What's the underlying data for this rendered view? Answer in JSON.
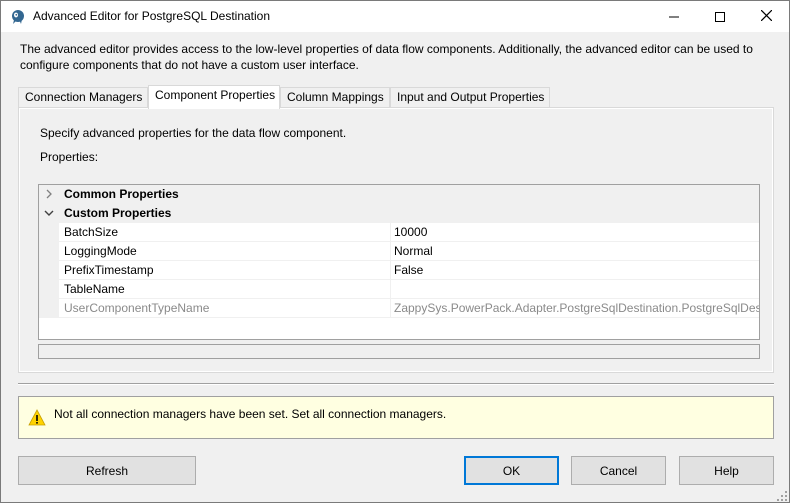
{
  "window": {
    "title": "Advanced Editor for PostgreSQL Destination"
  },
  "description": "The advanced editor provides access to the low-level properties of data flow components. Additionally, the advanced editor can be used to configure components that do not have a custom user interface.",
  "tabs": [
    {
      "label": "Connection Managers",
      "active": false
    },
    {
      "label": "Component Properties",
      "active": true
    },
    {
      "label": "Column Mappings",
      "active": false
    },
    {
      "label": "Input and Output Properties",
      "active": false
    }
  ],
  "panel": {
    "instruction": "Specify advanced properties for the data flow component.",
    "properties_label": "Properties:"
  },
  "grid": {
    "categories": [
      {
        "label": "Common Properties",
        "expanded": false
      },
      {
        "label": "Custom Properties",
        "expanded": true
      }
    ],
    "properties": [
      {
        "name": "BatchSize",
        "value": "10000",
        "readonly": false
      },
      {
        "name": "LoggingMode",
        "value": "Normal",
        "readonly": false
      },
      {
        "name": "PrefixTimestamp",
        "value": "False",
        "readonly": false
      },
      {
        "name": "TableName",
        "value": "",
        "readonly": false
      },
      {
        "name": "UserComponentTypeName",
        "value": "ZappySys.PowerPack.Adapter.PostgreSqlDestination.PostgreSqlDestin",
        "readonly": true
      }
    ]
  },
  "warning": {
    "icon": "warning-icon",
    "text": "Not all connection managers have been set. Set all connection managers."
  },
  "buttons": {
    "refresh": "Refresh",
    "ok": "OK",
    "cancel": "Cancel",
    "help": "Help"
  },
  "colors": {
    "accent": "#0078d7",
    "warning_bg": "#ffffe1",
    "dialog_bg": "#f0f0f0"
  }
}
